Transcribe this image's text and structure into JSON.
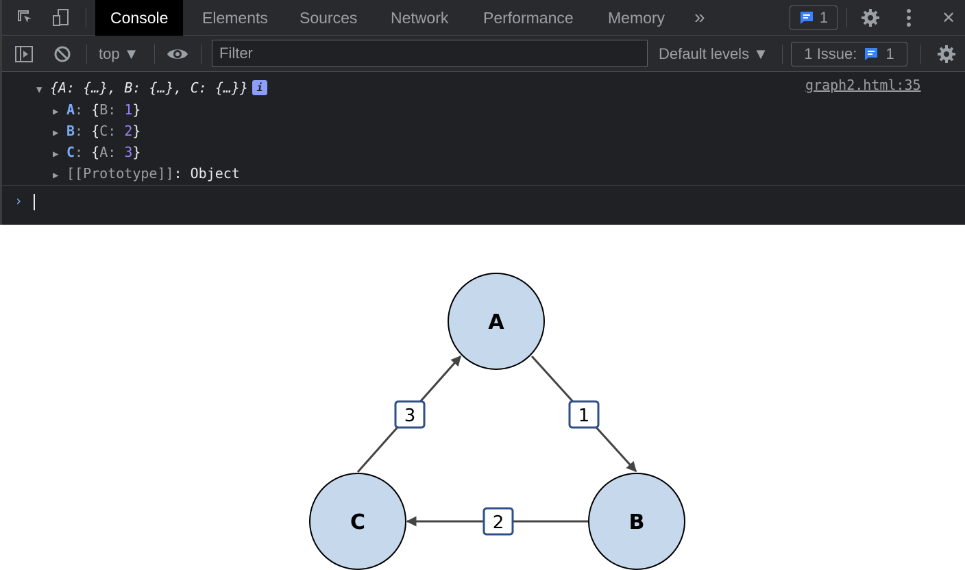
{
  "tabbar": {
    "tabs": [
      {
        "label": "Console",
        "active": true
      },
      {
        "label": "Elements"
      },
      {
        "label": "Sources"
      },
      {
        "label": "Network"
      },
      {
        "label": "Performance"
      },
      {
        "label": "Memory"
      }
    ],
    "more_label": "»",
    "messages_count": "1",
    "close_label": "✕"
  },
  "toolbar": {
    "context": "top ▼",
    "filter_placeholder": "Filter",
    "levels": "Default levels ▼",
    "issues_label": "1 Issue:",
    "issues_count": "1"
  },
  "console": {
    "summary": "{A: {…}, B: {…}, C: {…}}",
    "info_badge": "i",
    "source": "graph2.html:35",
    "entries": [
      {
        "key": "A",
        "open": "{",
        "inner_key": "B",
        "inner_val": "1",
        "close": "}"
      },
      {
        "key": "B",
        "open": "{",
        "inner_key": "C",
        "inner_val": "2",
        "close": "}"
      },
      {
        "key": "C",
        "open": "{",
        "inner_key": "A",
        "inner_val": "3",
        "close": "}"
      }
    ],
    "prototype_label": "[[Prototype]]",
    "prototype_value": "Object",
    "prompt": "›"
  },
  "graph": {
    "nodes": [
      "A",
      "B",
      "C"
    ],
    "edges": [
      {
        "from": "A",
        "to": "B",
        "weight": "1"
      },
      {
        "from": "B",
        "to": "C",
        "weight": "2"
      },
      {
        "from": "C",
        "to": "A",
        "weight": "3"
      }
    ],
    "node_fill": "#c5d8ec",
    "edge_label_border": "#2f4f8a"
  }
}
